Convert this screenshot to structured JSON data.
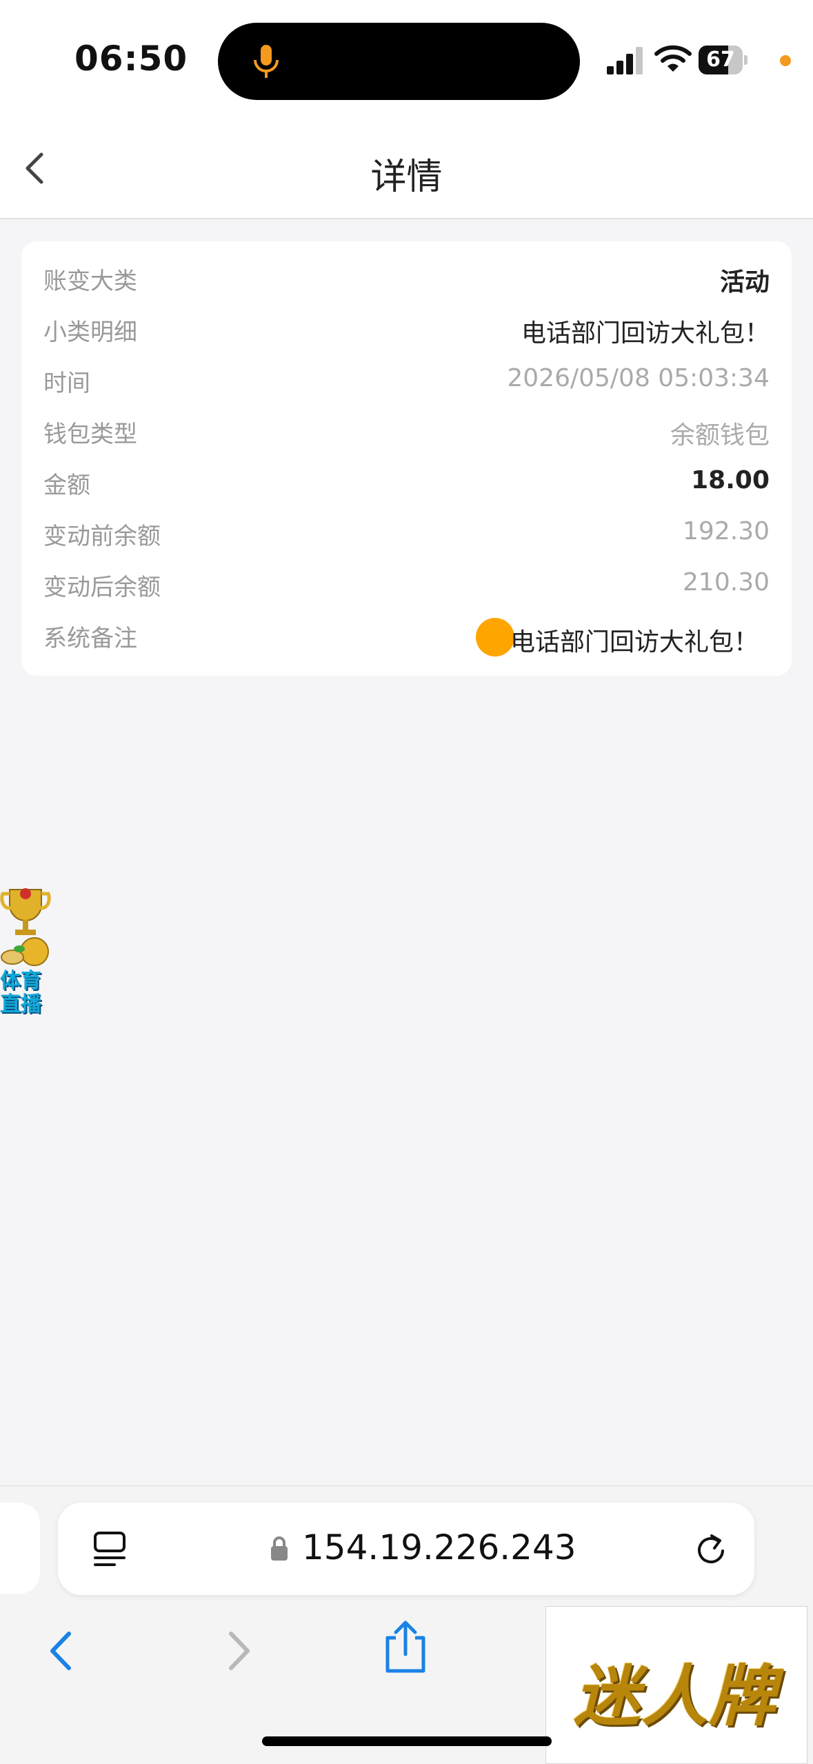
{
  "status_bar": {
    "time": "06:50",
    "battery": "67",
    "battery_level": 0.67,
    "icons": [
      "microphone-icon",
      "signal-icon",
      "wifi-icon",
      "battery-icon",
      "privacy-dot"
    ]
  },
  "header": {
    "title": "详情"
  },
  "details": [
    {
      "label": "账变大类",
      "value": "活动"
    },
    {
      "label": "小类明细",
      "value": "电话部门回访大礼包！"
    },
    {
      "label": "时间",
      "value": "2026/05/08 05:03:34"
    },
    {
      "label": "钱包类型",
      "value": "余额钱包"
    },
    {
      "label": "金额",
      "value": "18.00"
    },
    {
      "label": "变动前余额",
      "value": "192.30"
    },
    {
      "label": "变动后余额",
      "value": "210.30"
    },
    {
      "label": "系统备注",
      "value": "电话部门回访大礼包！"
    }
  ],
  "floating_badge": {
    "text": "体育直播"
  },
  "browser": {
    "url": "154.19.226.243"
  },
  "ad": {
    "text": "迷人牌"
  },
  "colors": {
    "accent_orange": "#ffa500",
    "mic_orange": "#f39a1f",
    "link_blue": "#1a82e6"
  }
}
